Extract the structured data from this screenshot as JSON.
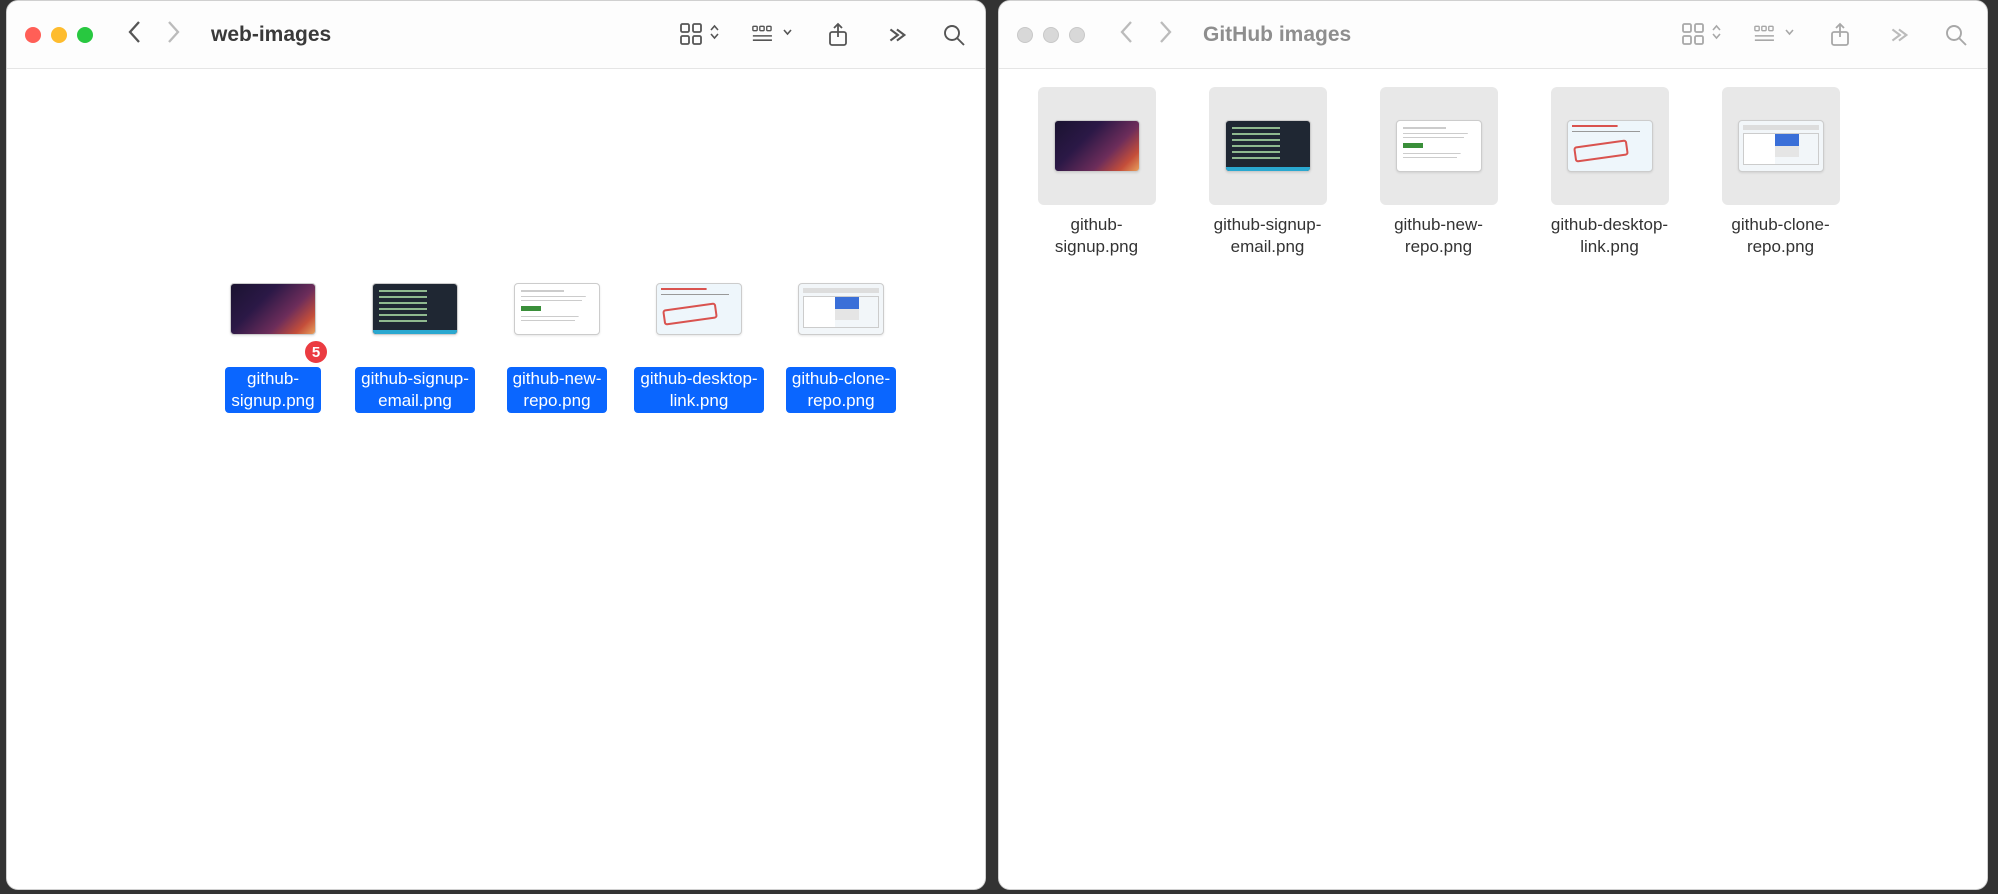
{
  "window1": {
    "title": "web-images",
    "active": true,
    "badge_count": "5",
    "files": [
      {
        "name": "github-\nsignup.png",
        "thumb": "dark",
        "selected": true,
        "badge": true
      },
      {
        "name": "github-signup-\nemail.png",
        "thumb": "code",
        "selected": true
      },
      {
        "name": "github-new-\nrepo.png",
        "thumb": "doc",
        "selected": true
      },
      {
        "name": "github-desktop-\nlink.png",
        "thumb": "annotated",
        "selected": true
      },
      {
        "name": "github-clone-\nrepo.png",
        "thumb": "clone",
        "selected": true
      }
    ]
  },
  "window2": {
    "title": "GitHub images",
    "active": false,
    "files": [
      {
        "name": "github-\nsignup.png",
        "thumb": "dark",
        "selected": false
      },
      {
        "name": "github-signup-\nemail.png",
        "thumb": "code",
        "selected": false
      },
      {
        "name": "github-new-\nrepo.png",
        "thumb": "doc",
        "selected": false
      },
      {
        "name": "github-desktop-\nlink.png",
        "thumb": "annotated",
        "selected": false
      },
      {
        "name": "github-clone-\nrepo.png",
        "thumb": "clone",
        "selected": false
      }
    ]
  }
}
